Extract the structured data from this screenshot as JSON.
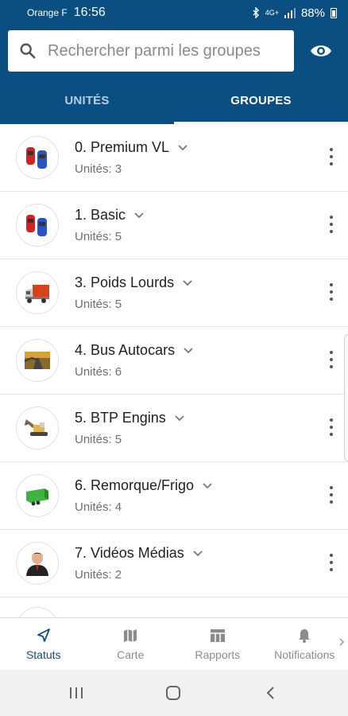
{
  "status_bar": {
    "carrier": "Orange F",
    "time": "16:56",
    "network": "4G+",
    "battery": "88%"
  },
  "search": {
    "placeholder": "Rechercher parmi les groupes"
  },
  "tabs": [
    {
      "label": "UNITÉS",
      "active": false
    },
    {
      "label": "GROUPES",
      "active": true
    }
  ],
  "groups": [
    {
      "title": "0. Premium VL",
      "units_label": "Unités:",
      "count": "3",
      "icon": "cars-icon"
    },
    {
      "title": "1. Basic",
      "units_label": "Unités:",
      "count": "5",
      "icon": "cars-icon"
    },
    {
      "title": "3. Poids Lourds",
      "units_label": "Unités:",
      "count": "5",
      "icon": "truck-icon"
    },
    {
      "title": "4. Bus Autocars",
      "units_label": "Unités:",
      "count": "6",
      "icon": "road-photo-icon"
    },
    {
      "title": "5. BTP Engins",
      "units_label": "Unités:",
      "count": "5",
      "icon": "excavator-icon"
    },
    {
      "title": "6. Remorque/Frigo",
      "units_label": "Unités:",
      "count": "4",
      "icon": "trailer-icon"
    },
    {
      "title": "7. Vidéos Médias",
      "units_label": "Unités:",
      "count": "2",
      "icon": "person-icon"
    }
  ],
  "bottom_nav": [
    {
      "label": "Statuts",
      "icon": "navigation-arrow-icon",
      "active": true
    },
    {
      "label": "Carte",
      "icon": "map-icon",
      "active": false
    },
    {
      "label": "Rapports",
      "icon": "table-icon",
      "active": false
    },
    {
      "label": "Notifications",
      "icon": "bell-icon",
      "active": false
    }
  ],
  "colors": {
    "primary": "#0b4f82",
    "active_nav": "#0b4f82",
    "inactive_nav": "#8c8c8c"
  }
}
